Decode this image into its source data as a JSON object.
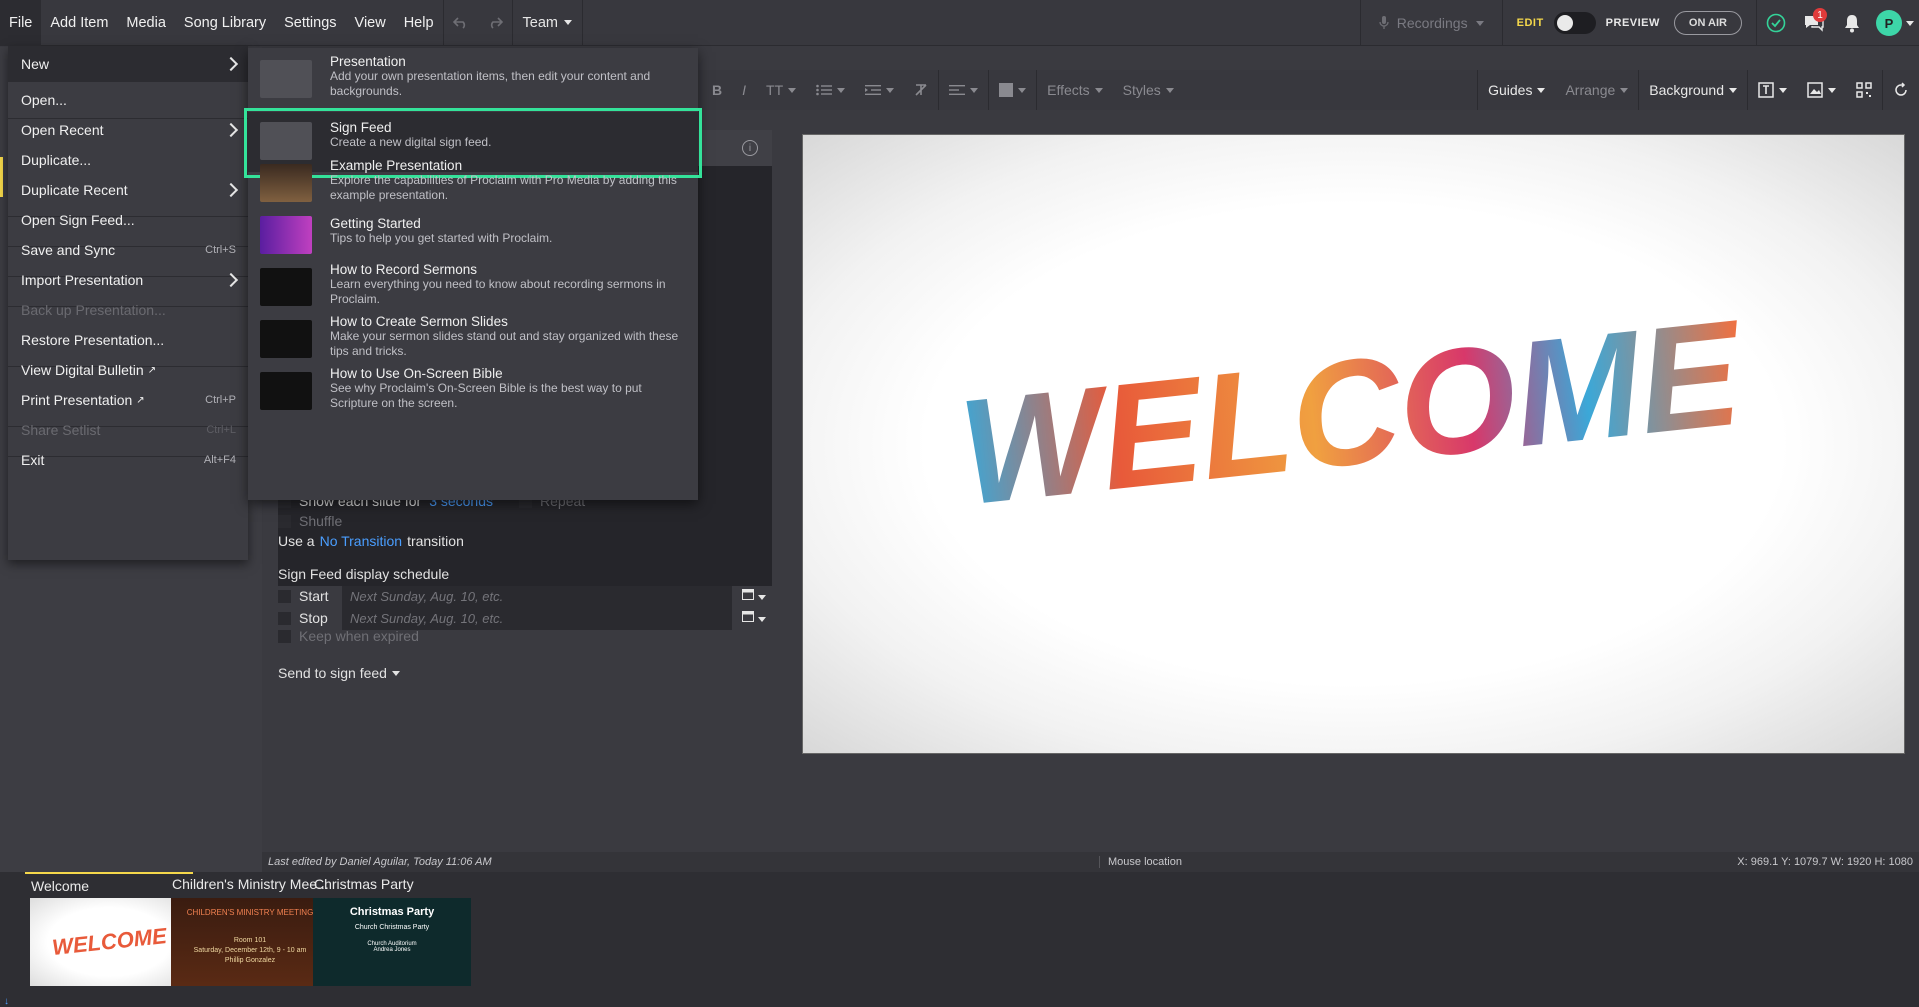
{
  "menubar": {
    "items": [
      "File",
      "Add Item",
      "Media",
      "Song Library",
      "Settings",
      "View",
      "Help"
    ],
    "team_label": "Team"
  },
  "topright": {
    "recordings_label": "Recordings",
    "edit_label": "EDIT",
    "preview_label": "PREVIEW",
    "onair_label": "ON AIR",
    "notification_count": "1",
    "avatar_letter": "P"
  },
  "toolbar": {
    "bold": "B",
    "italic": "I",
    "text_size": "TT",
    "effects": "Effects",
    "styles": "Styles",
    "guides": "Guides",
    "arrange": "Arrange",
    "background": "Background"
  },
  "file_menu": {
    "items": [
      {
        "label": "New",
        "shortcut": "",
        "submenu": true,
        "disabled": false
      },
      {
        "label": "Open...",
        "shortcut": "",
        "submenu": false,
        "disabled": false
      },
      {
        "label": "Open Recent",
        "shortcut": "",
        "submenu": true,
        "disabled": false
      },
      {
        "label": "Duplicate...",
        "shortcut": "",
        "submenu": false,
        "disabled": false
      },
      {
        "label": "Duplicate Recent",
        "shortcut": "",
        "submenu": true,
        "disabled": false
      },
      {
        "label": "Open Sign Feed...",
        "shortcut": "",
        "submenu": false,
        "disabled": false
      },
      {
        "label": "Save and Sync",
        "shortcut": "Ctrl+S",
        "submenu": false,
        "disabled": false
      },
      {
        "label": "Import Presentation",
        "shortcut": "",
        "submenu": true,
        "disabled": false
      },
      {
        "label": "Back up Presentation...",
        "shortcut": "",
        "submenu": false,
        "disabled": true
      },
      {
        "label": "Restore Presentation...",
        "shortcut": "",
        "submenu": false,
        "disabled": false
      },
      {
        "label": "View Digital Bulletin",
        "shortcut": "",
        "submenu": false,
        "disabled": false
      },
      {
        "label": "Print Presentation",
        "shortcut": "Ctrl+P",
        "submenu": false,
        "disabled": false
      },
      {
        "label": "Share Setlist",
        "shortcut": "Ctrl+L",
        "submenu": false,
        "disabled": true
      },
      {
        "label": "Exit",
        "shortcut": "Alt+F4",
        "submenu": false,
        "disabled": false
      }
    ]
  },
  "new_submenu": {
    "items": [
      {
        "title": "Presentation",
        "desc": "Add your own presentation items, then edit your content and backgrounds."
      },
      {
        "title": "Sign Feed",
        "desc": "Create a new digital sign feed."
      },
      {
        "title": "Example Presentation",
        "desc": "Explore the capabilities of Proclaim with Pro Media by adding this example presentation."
      },
      {
        "title": "Getting Started",
        "desc": "Tips to help you get started with Proclaim."
      },
      {
        "title": "How to Record Sermons",
        "desc": "Learn everything you need to know about recording sermons in Proclaim."
      },
      {
        "title": "How to Create Sermon Slides",
        "desc": "Make your sermon slides stand out and stay organized with these tips and tricks."
      },
      {
        "title": "How to Use On-Screen Bible",
        "desc": "See why Proclaim's On-Screen Bible is the best way to put Scripture on the screen."
      }
    ]
  },
  "settings": {
    "show_each_prefix": "Show each slide for",
    "show_each_value": "3 seconds",
    "repeat": "Repeat",
    "shuffle": "Shuffle",
    "use_a": "Use a",
    "transition_value": "No Transition",
    "transition_suffix": "transition",
    "schedule_heading": "Sign Feed display schedule",
    "start_label": "Start",
    "stop_label": "Stop",
    "start_placeholder": "Next Sunday, Aug. 10, etc.",
    "stop_placeholder": "Next Sunday, Aug. 10, etc.",
    "keep_when_expired": "Keep when expired",
    "send_to_sign_feed": "Send to sign feed"
  },
  "statusbar": {
    "last_edited": "Last edited by Daniel Aguilar, Today 11:06 AM",
    "mouse_location": "Mouse location",
    "coords": "X: 969.1   Y: 1079.7     W: 1920   H: 1080"
  },
  "strip": {
    "items": [
      {
        "title": "Welcome",
        "active": true
      },
      {
        "title": "Children's Ministry Mee...",
        "active": false
      },
      {
        "title": "Christmas Party",
        "active": false
      }
    ],
    "christmas": {
      "title": "Christmas Party",
      "subtitle": "Church Christmas Party",
      "place": "Church Auditorium",
      "name": "Andrea Jones"
    },
    "children": {
      "title": "CHILDREN'S MINISTRY MEETING",
      "room": "Room 101",
      "date": "Saturday, December 12th, 9 - 10 am",
      "name": "Phillip Gonzalez"
    }
  },
  "canvas": {
    "word": "WELCOME"
  }
}
